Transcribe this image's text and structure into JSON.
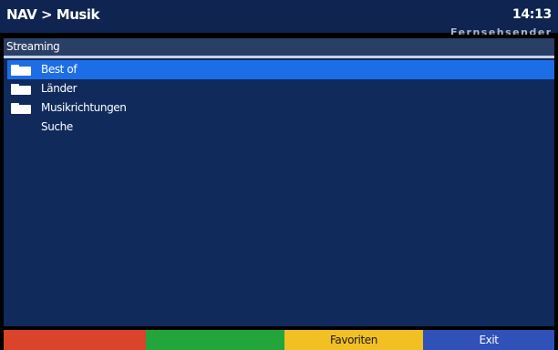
{
  "header": {
    "breadcrumb": "NAV > Musik",
    "clock": "14:13",
    "ticker": "Fernsehsender"
  },
  "section": {
    "title": "Streaming"
  },
  "list": {
    "items": [
      {
        "label": "Best of",
        "icon": "folder-icon",
        "selected": true
      },
      {
        "label": "Länder",
        "icon": "folder-icon",
        "selected": false
      },
      {
        "label": "Musikrichtungen",
        "icon": "folder-icon",
        "selected": false
      },
      {
        "label": "Suche",
        "icon": "",
        "selected": false
      }
    ]
  },
  "footer": {
    "red_label": "",
    "green_label": "",
    "yellow_label": "Favoriten",
    "blue_label": "Exit"
  },
  "colors": {
    "title_bg": "#0f2450",
    "main_bg": "#102a5c",
    "selection": "#1d6ee6",
    "red_key": "#d9442b",
    "green_key": "#22a63c",
    "yellow_key": "#f2c023",
    "blue_key": "#2f51b8"
  }
}
